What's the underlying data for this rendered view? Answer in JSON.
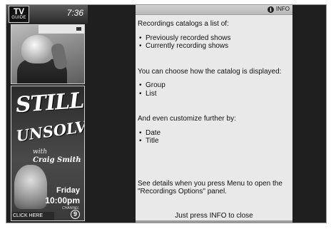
{
  "header": {
    "logo_line1": "TV",
    "logo_line2": "GUIDE",
    "time": "7:36"
  },
  "promo": {
    "title_line1": "STILL",
    "title_line2": "UNSOLVED",
    "with_text": "with",
    "host": "Craig Smith",
    "day": "Friday",
    "time": "10:00pm",
    "channel_label": "CHANNEL",
    "channel_number": "9",
    "click_label": "CLICK HERE"
  },
  "info_panel": {
    "header_label": "INFO",
    "intro": "Recordings catalogs a list of:",
    "list1": [
      "Previously recorded shows",
      "Currently recording shows"
    ],
    "choose_text": "You can choose how the catalog is displayed:",
    "list2": [
      "Group",
      "List"
    ],
    "customize_text": "And even customize further by:",
    "list3": [
      "Date",
      "Title"
    ],
    "details_text": "See details when you press Menu to open the \"Recordings Options\" panel.",
    "close_hint": "Just press INFO to close"
  }
}
